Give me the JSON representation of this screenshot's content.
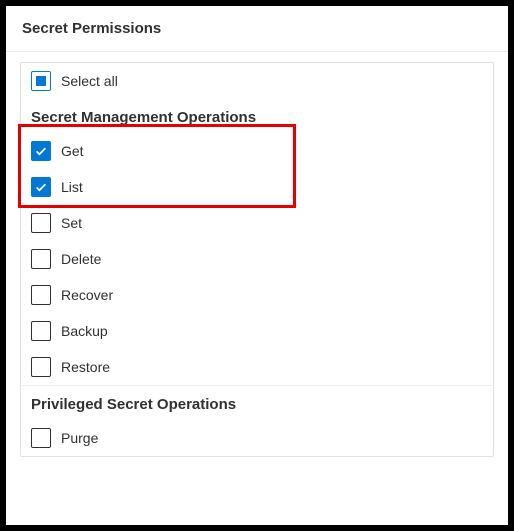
{
  "header": {
    "title": "Secret Permissions"
  },
  "selectAll": {
    "label": "Select all",
    "state": "indeterminate"
  },
  "sections": {
    "management": {
      "label": "Secret Management Operations"
    },
    "privileged": {
      "label": "Privileged Secret Operations"
    }
  },
  "items": {
    "get": {
      "label": "Get",
      "checked": true
    },
    "list": {
      "label": "List",
      "checked": true
    },
    "set": {
      "label": "Set",
      "checked": false
    },
    "delete": {
      "label": "Delete",
      "checked": false
    },
    "recover": {
      "label": "Recover",
      "checked": false
    },
    "backup": {
      "label": "Backup",
      "checked": false
    },
    "restore": {
      "label": "Restore",
      "checked": false
    },
    "purge": {
      "label": "Purge",
      "checked": false
    }
  },
  "highlight": {
    "color": "#e60000"
  }
}
